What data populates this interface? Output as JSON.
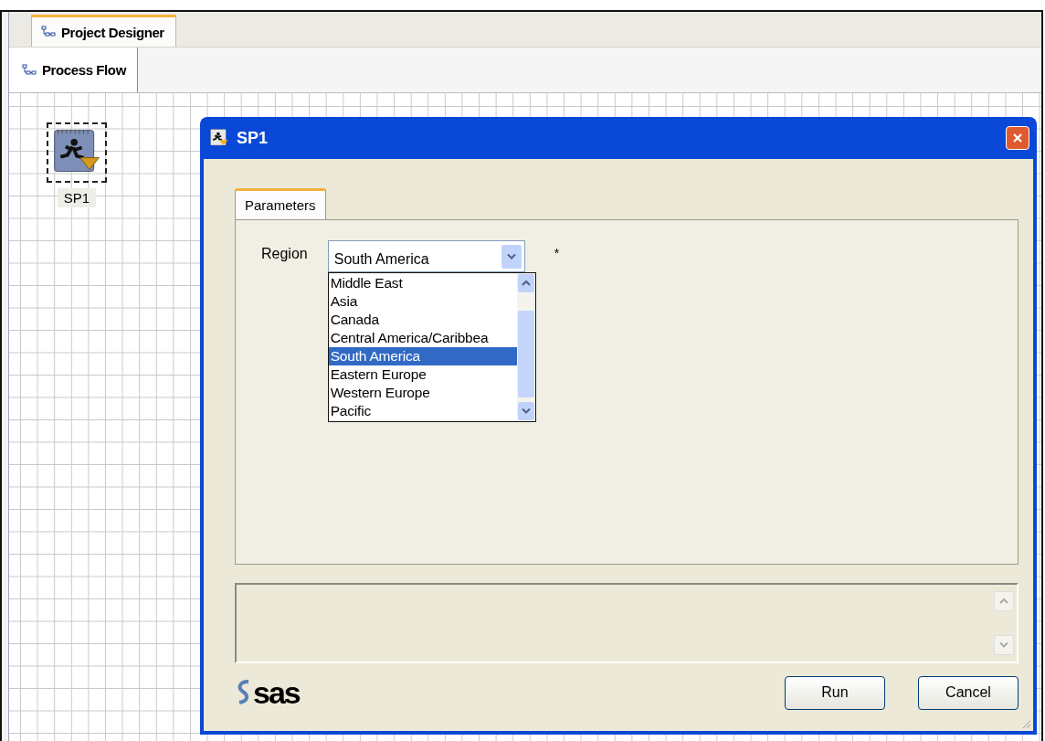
{
  "outer_tab": {
    "label": "Project Designer",
    "selected": true
  },
  "inner_tab": {
    "label": "Process Flow"
  },
  "node": {
    "label": "SP1",
    "selected": true
  },
  "dialog": {
    "title": "SP1",
    "tabs": [
      {
        "label": "Parameters",
        "selected": true
      }
    ],
    "parameter": {
      "label": "Region",
      "value": "South America",
      "required_mark": "*",
      "options": [
        {
          "label": "Middle East",
          "selected": false
        },
        {
          "label": "Asia",
          "selected": false
        },
        {
          "label": "Canada",
          "selected": false
        },
        {
          "label": "Central America/Caribbea",
          "selected": false
        },
        {
          "label": "South America",
          "selected": true
        },
        {
          "label": "Eastern Europe",
          "selected": false
        },
        {
          "label": "Western Europe",
          "selected": false
        },
        {
          "label": "Pacific",
          "selected": false
        }
      ]
    },
    "logo_text": "sas",
    "buttons": [
      "Run",
      "Cancel"
    ]
  }
}
